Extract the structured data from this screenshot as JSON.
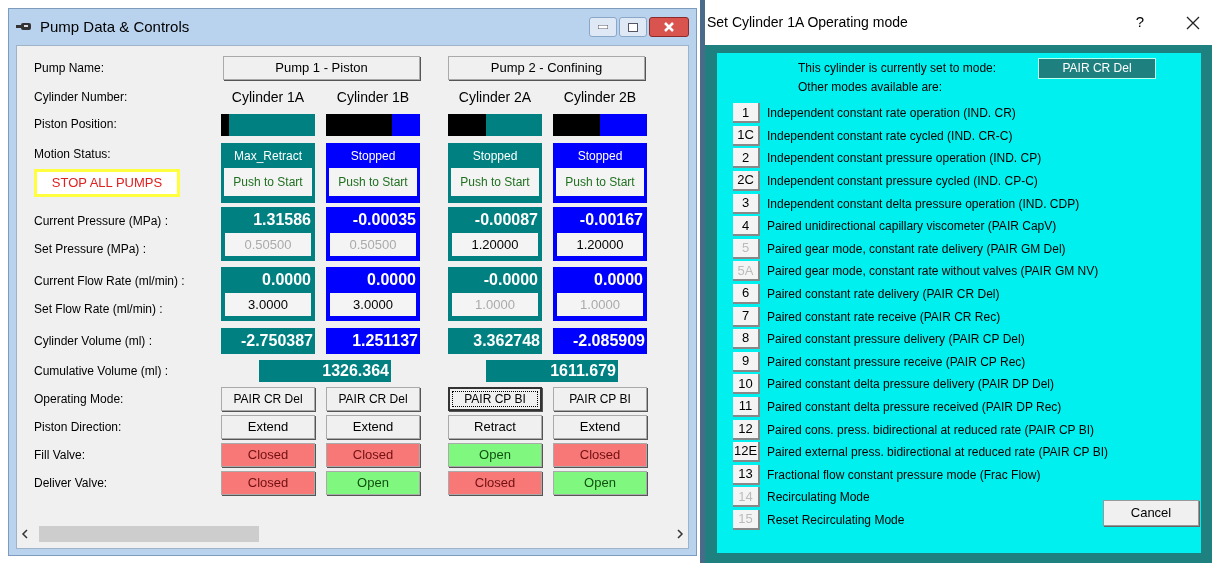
{
  "window": {
    "title": "Pump Data & Controls"
  },
  "labels": {
    "pump_name": "Pump Name:",
    "cylinder_number": "Cylinder Number:",
    "piston_position": "Piston Position:",
    "motion_status": "Motion Status:",
    "current_pressure": "Current Pressure (MPa) :",
    "set_pressure": "Set Pressure (MPa) :",
    "current_flow_rate": "Current Flow Rate (ml/min) :",
    "set_flow_rate": "Set Flow Rate (ml/min) :",
    "cylinder_volume": "Cylinder Volume (ml) :",
    "cumulative_volume": "Cumulative Volume (ml) :",
    "operating_mode": "Operating Mode:",
    "piston_direction": "Piston Direction:",
    "fill_valve": "Fill Valve:",
    "deliver_valve": "Deliver Valve:"
  },
  "stop_button": "STOP ALL PUMPS",
  "pumps": [
    {
      "name": "Pump 1 - Piston",
      "cumulative_volume": "1326.364",
      "cylinders": [
        {
          "number": "Cylinder 1A",
          "color": "#008080",
          "level": 0.92,
          "motion_status": "Max_Retract",
          "start_button": "Push to Start",
          "current_pressure": "1.31586",
          "set_pressure": {
            "value": "0.50500",
            "disabled": true
          },
          "current_flow_rate": "0.0000",
          "set_flow_rate": {
            "value": "3.0000",
            "disabled": false
          },
          "volume": "-2.750387",
          "mode": {
            "label": "PAIR CR Del",
            "focused": false
          },
          "direction": "Extend",
          "fill_valve": {
            "label": "Closed",
            "open": false
          },
          "deliver_valve": {
            "label": "Closed",
            "open": false
          }
        },
        {
          "number": "Cylinder 1B",
          "color": "#0000ff",
          "level": 0.3,
          "motion_status": "Stopped",
          "start_button": "Push to Start",
          "current_pressure": "-0.00035",
          "set_pressure": {
            "value": "0.50500",
            "disabled": true
          },
          "current_flow_rate": "0.0000",
          "set_flow_rate": {
            "value": "3.0000",
            "disabled": false
          },
          "volume": "1.251137",
          "mode": {
            "label": "PAIR CR Del",
            "focused": false
          },
          "direction": "Extend",
          "fill_valve": {
            "label": "Closed",
            "open": false
          },
          "deliver_valve": {
            "label": "Open",
            "open": true
          }
        }
      ]
    },
    {
      "name": "Pump 2 - Confining",
      "cumulative_volume": "1611.679",
      "cylinders": [
        {
          "number": "Cylinder 2A",
          "color": "#008080",
          "level": 0.6,
          "motion_status": "Stopped",
          "start_button": "Push to Start",
          "current_pressure": "-0.00087",
          "set_pressure": {
            "value": "1.20000",
            "disabled": false
          },
          "current_flow_rate": "-0.0000",
          "set_flow_rate": {
            "value": "1.0000",
            "disabled": true
          },
          "volume": "3.362748",
          "mode": {
            "label": "PAIR CP BI",
            "focused": true
          },
          "direction": "Retract",
          "fill_valve": {
            "label": "Open",
            "open": true
          },
          "deliver_valve": {
            "label": "Closed",
            "open": false
          }
        },
        {
          "number": "Cylinder 2B",
          "color": "#0000ff",
          "level": 0.5,
          "motion_status": "Stopped",
          "start_button": "Push to Start",
          "current_pressure": "-0.00167",
          "set_pressure": {
            "value": "1.20000",
            "disabled": false
          },
          "current_flow_rate": "0.0000",
          "set_flow_rate": {
            "value": "1.0000",
            "disabled": true
          },
          "volume": "-2.085909",
          "mode": {
            "label": "PAIR CP BI",
            "focused": false
          },
          "direction": "Extend",
          "fill_valve": {
            "label": "Closed",
            "open": false
          },
          "deliver_valve": {
            "label": "Open",
            "open": true
          }
        }
      ]
    }
  ],
  "dialog": {
    "title": "Set Cylinder 1A Operating mode",
    "help": "?",
    "current_label": "This cylinder is currently set to mode:",
    "current_mode": "PAIR CR Del",
    "other_label": "Other modes available are:",
    "cancel": "Cancel",
    "modes": [
      {
        "key": "1",
        "label": "Independent constant rate operation (IND. CR)",
        "disabled": false
      },
      {
        "key": "1C",
        "label": "Independent constant rate cycled (IND. CR-C)",
        "disabled": false
      },
      {
        "key": "2",
        "label": "Independent constant pressure operation (IND. CP)",
        "disabled": false
      },
      {
        "key": "2C",
        "label": "Independent constant pressure cycled (IND. CP-C)",
        "disabled": false
      },
      {
        "key": "3",
        "label": "Independent constant delta pressure operation (IND. CDP)",
        "disabled": false
      },
      {
        "key": "4",
        "label": "Paired unidirectional capillary viscometer (PAIR CapV)",
        "disabled": false
      },
      {
        "key": "5",
        "label": "Paired gear mode, constant rate delivery (PAIR GM Del)",
        "disabled": true
      },
      {
        "key": "5A",
        "label": "Paired gear mode, constant rate without valves (PAIR GM NV)",
        "disabled": true
      },
      {
        "key": "6",
        "label": "Paired constant rate delivery (PAIR CR Del)",
        "disabled": false
      },
      {
        "key": "7",
        "label": "Paired constant rate receive (PAIR CR Rec)",
        "disabled": false
      },
      {
        "key": "8",
        "label": "Paired constant pressure delivery (PAIR CP Del)",
        "disabled": false
      },
      {
        "key": "9",
        "label": "Paired constant pressure receive (PAIR CP Rec)",
        "disabled": false
      },
      {
        "key": "10",
        "label": "Paired constant delta pressure delivery (PAIR DP Del)",
        "disabled": false
      },
      {
        "key": "11",
        "label": "Paired constant delta pressure received (PAIR DP Rec)",
        "disabled": false
      },
      {
        "key": "12",
        "label": "Paired cons. press. bidirectional at reduced rate (PAIR CP BI)",
        "disabled": false
      },
      {
        "key": "12E",
        "label": "Paired external press. bidirectional at reduced rate (PAIR CP BI)",
        "disabled": false
      },
      {
        "key": "13",
        "label": "Fractional flow constant pressure mode (Frac Flow)",
        "disabled": false
      },
      {
        "key": "14",
        "label": "Recirculating Mode",
        "disabled": true
      },
      {
        "key": "15",
        "label": "Reset Recirculating Mode",
        "disabled": true
      }
    ]
  }
}
